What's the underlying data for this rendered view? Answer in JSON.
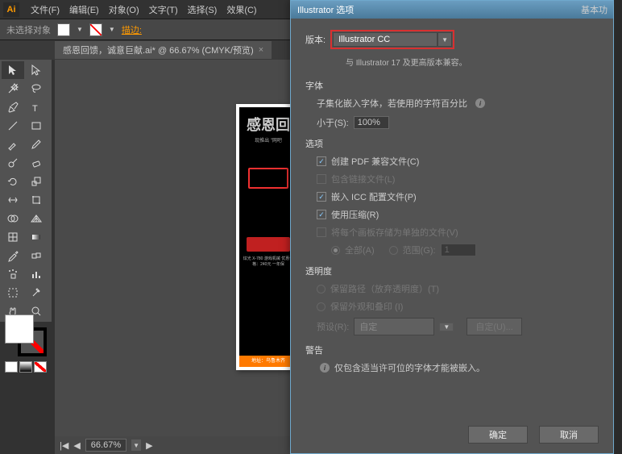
{
  "app_icon": "Ai",
  "menu": [
    "文件(F)",
    "编辑(E)",
    "对象(O)",
    "文字(T)",
    "选择(S)",
    "效果(C)"
  ],
  "menu_extra": "基本功",
  "control": {
    "no_selection": "未选择对象",
    "stroke": "描边:"
  },
  "tab": {
    "title": "感恩回馈，诚意巨献.ai* @ 66.67% (CMYK/预览)"
  },
  "artwork": {
    "title": "感恩回",
    "sub": "现推出 \"网吧",
    "price": "炫光 X-780 游戏机械\n优惠价格：240元\n一年保",
    "footer": "地址：乌鲁木齐"
  },
  "status": {
    "zoom": "66.67%"
  },
  "dialog": {
    "title": "Illustrator 选项",
    "version_label": "版本:",
    "version_value": "Illustrator CC",
    "compat": "与 Illustrator 17 及更高版本兼容。",
    "fonts_header": "字体",
    "fonts_subset": "子集化嵌入字体，若使用的字符百分比",
    "fonts_less": "小于(S):",
    "fonts_pct": "100%",
    "options_header": "选项",
    "opt_pdf": "创建 PDF 兼容文件(C)",
    "opt_link": "包含链接文件(L)",
    "opt_icc": "嵌入 ICC 配置文件(P)",
    "opt_compress": "使用压缩(R)",
    "opt_artboards": "将每个画板存储为单独的文件(V)",
    "opt_all": "全部(A)",
    "opt_range": "范围(G):",
    "opt_range_val": "1",
    "trans_header": "透明度",
    "trans_keep": "保留路径（放弃透明度）(T)",
    "trans_flatten": "保留外观和叠印 (I)",
    "preset_label": "预设(R):",
    "preset_value": "自定",
    "preset_custom": "自定(U)...",
    "warn_header": "警告",
    "warn_text": "仅包含适当许可位的字体才能被嵌入。",
    "ok": "确定",
    "cancel": "取消"
  }
}
